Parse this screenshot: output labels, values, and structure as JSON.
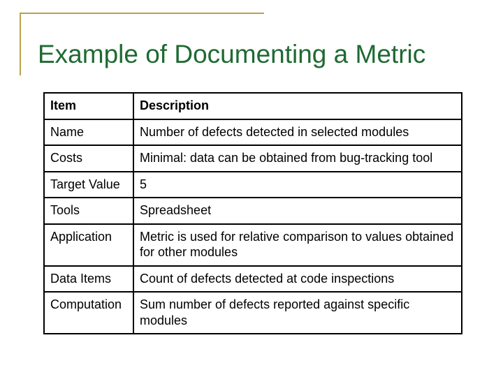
{
  "title": "Example of Documenting a Metric",
  "table": {
    "header": {
      "item": "Item",
      "description": "Description"
    },
    "rows": [
      {
        "item": "Name",
        "description": "Number of defects detected in selected modules"
      },
      {
        "item": "Costs",
        "description": "Minimal: data can be obtained from bug-tracking tool"
      },
      {
        "item": "Target Value",
        "description": "5"
      },
      {
        "item": "Tools",
        "description": "Spreadsheet"
      },
      {
        "item": "Application",
        "description": "Metric is used for relative comparison to values obtained for other modules"
      },
      {
        "item": "Data Items",
        "description": "Count of defects detected at code inspections"
      },
      {
        "item": "Computation",
        "description": "Sum number of defects reported against specific modules"
      }
    ]
  }
}
